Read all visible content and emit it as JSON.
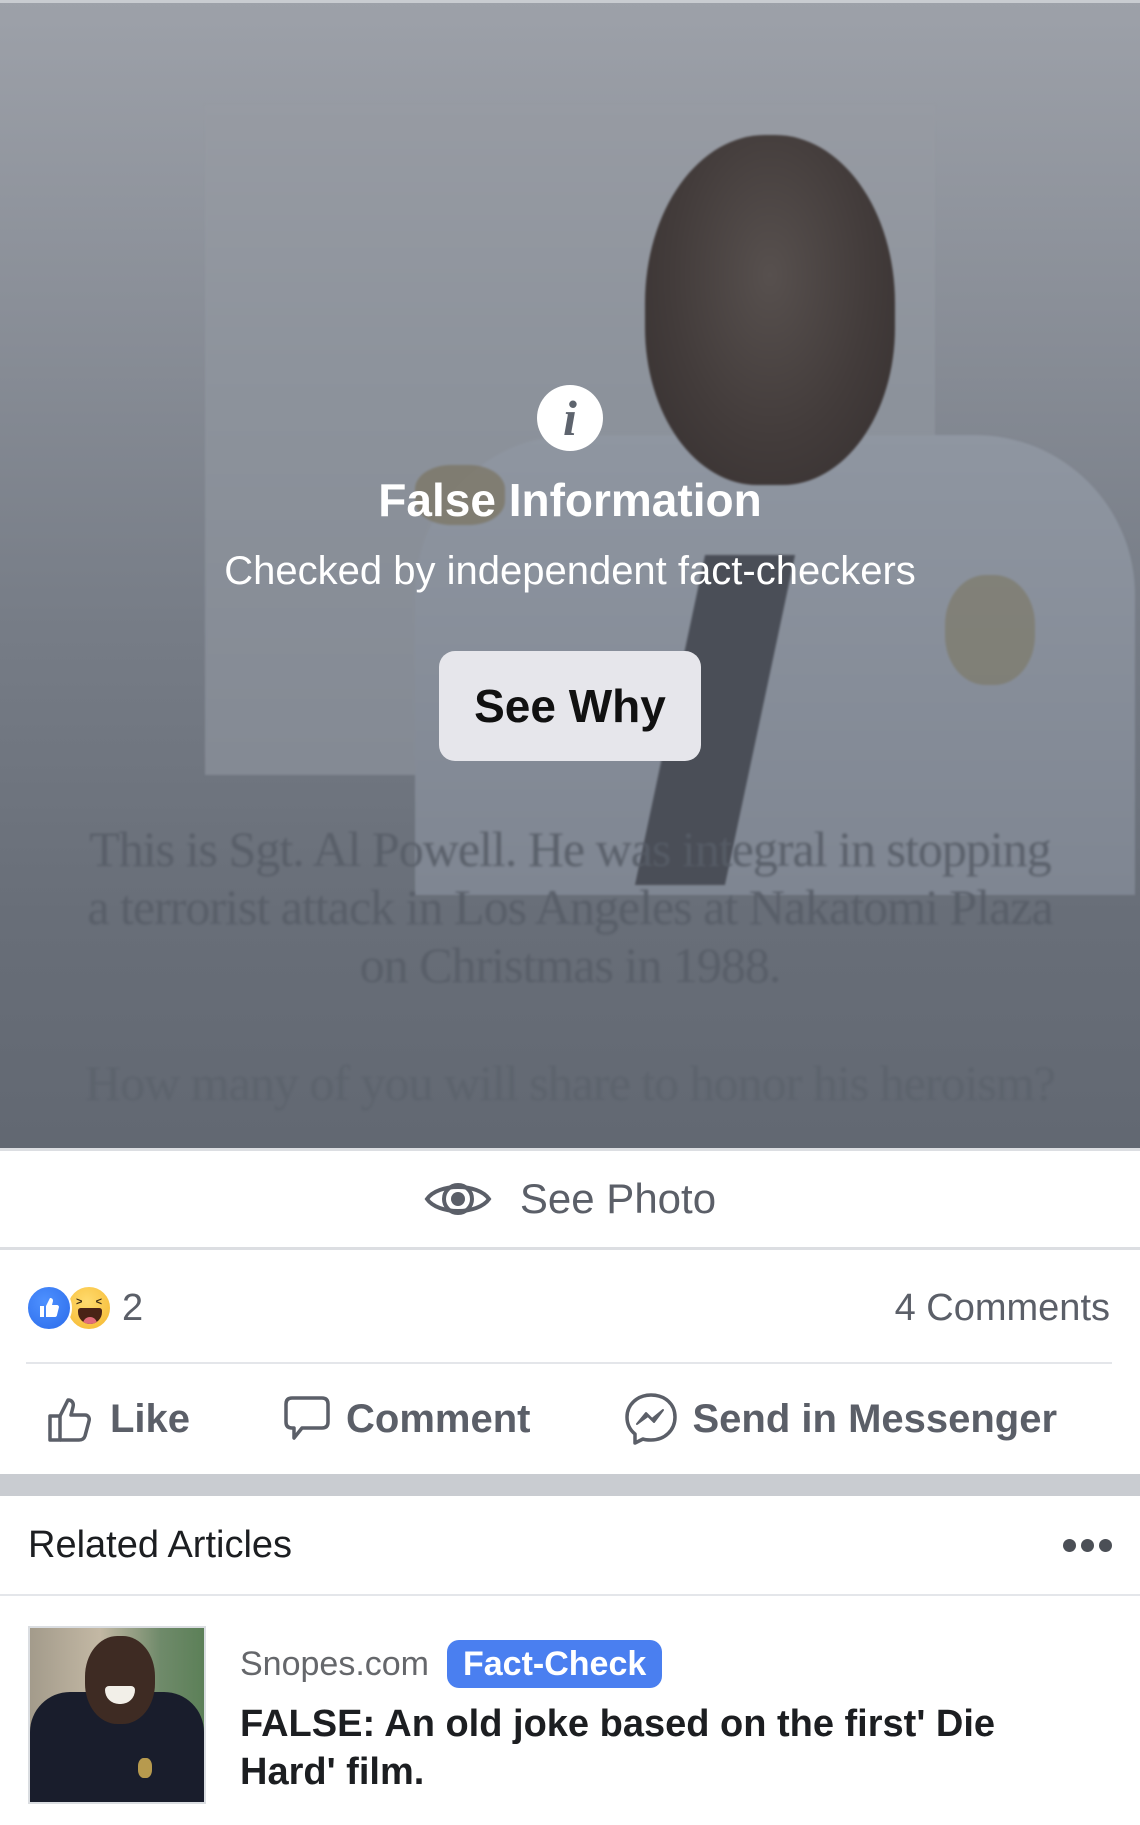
{
  "warning": {
    "icon": "info-icon",
    "title": "False Information",
    "subtitle": "Checked by independent fact-checkers",
    "button_label": "See Why"
  },
  "hidden_post": {
    "caption_line1": "This is Sgt. Al Powell. He was integral in stopping",
    "caption_line2": "a terrorist attack in Los Angeles at Nakatomi Plaza",
    "caption_line3": "on Christmas in 1988.",
    "caption_question": "How many of you will share to honor his heroism?"
  },
  "see_photo": {
    "icon": "eye-icon",
    "label": "See Photo"
  },
  "reactions": {
    "types": [
      "like",
      "haha"
    ],
    "count": "2",
    "comments": "4 Comments"
  },
  "actions": {
    "like": "Like",
    "comment": "Comment",
    "messenger": "Send in Messenger"
  },
  "related": {
    "title": "Related Articles",
    "more_icon": "more-horizontal-icon",
    "articles": [
      {
        "source": "Snopes.com",
        "badge": "Fact-Check",
        "headline": "FALSE: An old joke based on the first' Die Hard' film."
      }
    ]
  },
  "colors": {
    "overlay": "#6b717b",
    "text_secondary": "#5b5f68",
    "badge_blue": "#4a7ff0",
    "like_blue": "#2b6bea",
    "haha_yellow": "#f5b72e",
    "button_bg": "#e6e6eb",
    "section_gap": "#c9ccd1"
  }
}
